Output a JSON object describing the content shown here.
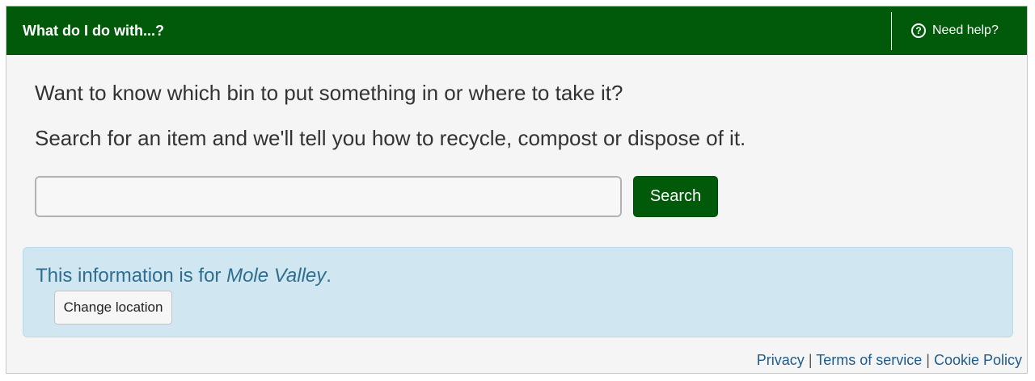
{
  "header": {
    "title": "What do I do with...?",
    "help_label": "Need help?",
    "help_icon": "question-circle-icon"
  },
  "intro": {
    "line1": "Want to know which bin to put something in or where to take it?",
    "line2": "Search for an item and we'll tell you how to recycle, compost or dispose of it."
  },
  "search": {
    "value": "",
    "placeholder": "",
    "button_label": "Search"
  },
  "location": {
    "prefix": "This information is for ",
    "name": "Mole Valley",
    "suffix": ".",
    "change_label": "Change location"
  },
  "footer": {
    "links": [
      "Privacy",
      "Terms of service",
      "Cookie Policy"
    ],
    "separator": "|"
  },
  "colors": {
    "brand_green": "#005a0a",
    "info_background": "#d0e7f2",
    "info_text": "#2f6e8e",
    "link_blue": "#1f5b8a"
  }
}
